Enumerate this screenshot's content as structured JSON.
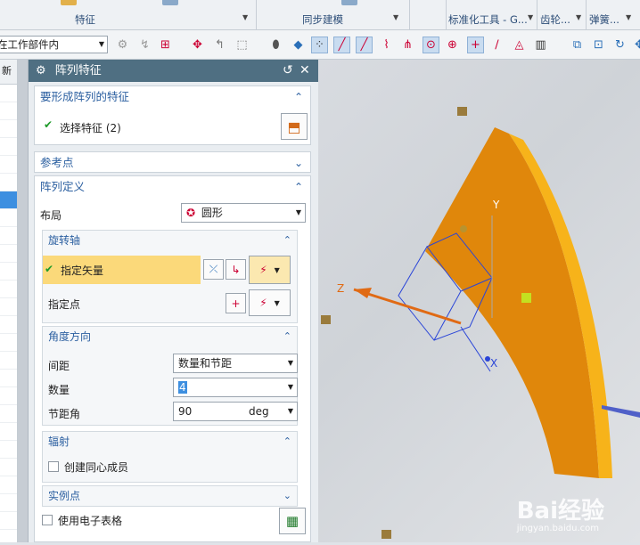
{
  "ribbon": {
    "groups": [
      "特征",
      "同步建模",
      "标准化工具 - G...",
      "齿轮...",
      "弹簧..."
    ]
  },
  "toolbar": {
    "scope_value": "在工作部件内"
  },
  "left_panel": {
    "header": "新"
  },
  "dialog": {
    "title": "阵列特征",
    "sections": {
      "features": {
        "header": "要形成阵列的特征",
        "select_label": "选择特征 (2)"
      },
      "reference": {
        "header": "参考点"
      },
      "array_def": {
        "header": "阵列定义",
        "layout_label": "布局",
        "layout_value": "圆形",
        "rotation_axis": {
          "header": "旋转轴",
          "vector_label": "指定矢量",
          "point_label": "指定点"
        },
        "angle_direction": {
          "header": "角度方向",
          "spacing_label": "间距",
          "spacing_value": "数量和节距",
          "count_label": "数量",
          "count_value": "4",
          "pitch_label": "节距角",
          "pitch_value": "90",
          "pitch_unit": "deg"
        },
        "radiation": {
          "header": "辐射",
          "concentric_label": "创建同心成员"
        },
        "instance_points": {
          "header": "实例点"
        },
        "spreadsheet_label": "使用电子表格"
      }
    }
  },
  "viewport": {
    "axis_labels": [
      "Y",
      "Z",
      "X"
    ],
    "watermark_main": "Bai经验",
    "watermark_url": "jingyan.baidu.com"
  },
  "colors": {
    "dialog_title_bar": "#4f6f82",
    "section_header": "#2b5fa0",
    "highlight_row": "#fbd97a",
    "part_face": "#e0870b",
    "part_edge": "#f7b31a"
  }
}
